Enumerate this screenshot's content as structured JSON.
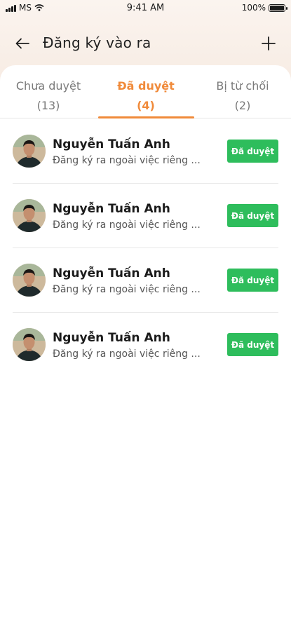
{
  "status_bar": {
    "carrier": "MS",
    "time": "9:41 AM",
    "battery": "100%"
  },
  "header": {
    "title": "Đăng ký vào ra",
    "back_icon": "arrow-left-icon",
    "add_icon": "plus-icon"
  },
  "tabs": [
    {
      "label": "Chưa duyệt",
      "count": "(13)",
      "active": false
    },
    {
      "label": "Đã duyệt",
      "count": "(4)",
      "active": true
    },
    {
      "label": "Bị từ chối",
      "count": "(2)",
      "active": false
    }
  ],
  "colors": {
    "accent": "#f08a3a",
    "approved": "#2ebd5c"
  },
  "requests": [
    {
      "name": "Nguyễn Tuấn Anh",
      "description": "Đăng ký ra ngoài việc riêng ...",
      "status": "Đã duyệt"
    },
    {
      "name": "Nguyễn Tuấn Anh",
      "description": "Đăng ký ra ngoài việc riêng ...",
      "status": "Đã duyệt"
    },
    {
      "name": "Nguyễn Tuấn Anh",
      "description": "Đăng ký ra ngoài việc riêng ...",
      "status": "Đã duyệt"
    },
    {
      "name": "Nguyễn Tuấn Anh",
      "description": "Đăng ký ra ngoài việc riêng ...",
      "status": "Đã duyệt"
    }
  ]
}
